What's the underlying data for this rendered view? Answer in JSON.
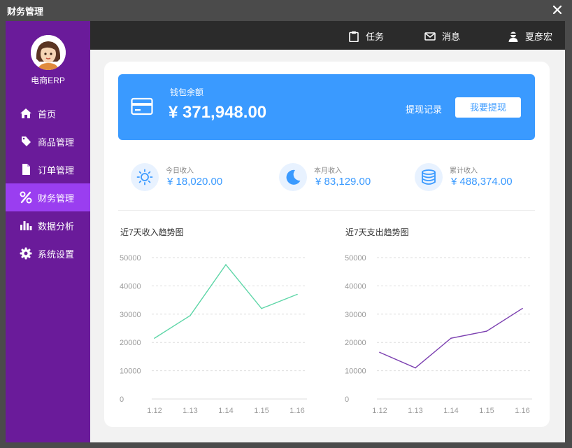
{
  "window": {
    "title": "财务管理",
    "close_icon": "close-icon"
  },
  "sidebar": {
    "brand": "电商ERP",
    "items": [
      {
        "label": "首页",
        "icon": "home-icon",
        "active": false
      },
      {
        "label": "商品管理",
        "icon": "tag-icon",
        "active": false
      },
      {
        "label": "订单管理",
        "icon": "document-icon",
        "active": false
      },
      {
        "label": "财务管理",
        "icon": "percent-icon",
        "active": true
      },
      {
        "label": "数据分析",
        "icon": "bar-chart-icon",
        "active": false
      },
      {
        "label": "系统设置",
        "icon": "gear-icon",
        "active": false
      }
    ]
  },
  "topbar": {
    "tasks": "任务",
    "messages": "消息",
    "user": "夏彦宏"
  },
  "wallet": {
    "label": "钱包余额",
    "amount": "¥ 371,948.00",
    "records": "提现记录",
    "withdraw": "我要提现"
  },
  "stats": [
    {
      "label": "今日收入",
      "value": "¥ 18,020.00",
      "icon": "sun-icon"
    },
    {
      "label": "本月收入",
      "value": "¥ 83,129.00",
      "icon": "moon-icon"
    },
    {
      "label": "累计收入",
      "value": "¥ 488,374.00",
      "icon": "database-icon"
    }
  ],
  "colors": {
    "sidebar": "#6a1b9a",
    "active": "#9a3ef0",
    "accent": "#3a9aff",
    "income_line": "#5fd6a8",
    "expense_line": "#7b3fb0"
  },
  "chart_data": [
    {
      "type": "line",
      "title": "近7天收入趋势图",
      "x": [
        "1.12",
        "1.13",
        "1.14",
        "1.15",
        "1.16"
      ],
      "y_ticks": [
        0,
        10000,
        20000,
        30000,
        40000,
        50000
      ],
      "ylim": [
        0,
        50000
      ],
      "series": [
        {
          "values": [
            21500,
            29500,
            47500,
            32000,
            37000
          ]
        }
      ],
      "grid": true
    },
    {
      "type": "line",
      "title": "近7天支出趋势图",
      "x": [
        "1.12",
        "1.13",
        "1.14",
        "1.15",
        "1.16"
      ],
      "y_ticks": [
        0,
        10000,
        20000,
        30000,
        40000,
        50000
      ],
      "ylim": [
        0,
        50000
      ],
      "series": [
        {
          "values": [
            16500,
            11000,
            21500,
            24000,
            32000
          ]
        }
      ],
      "grid": true
    }
  ]
}
